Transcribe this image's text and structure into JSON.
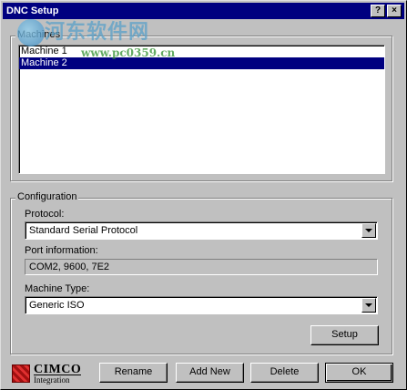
{
  "window": {
    "title": "DNC Setup",
    "help_label": "?",
    "close_label": "×"
  },
  "watermark": {
    "text": "河东软件网",
    "url": "www.pc0359.cn"
  },
  "machines": {
    "group_label": "Machines",
    "items": [
      {
        "label": "Machine 1",
        "selected": false
      },
      {
        "label": "Machine 2",
        "selected": true
      }
    ]
  },
  "configuration": {
    "group_label": "Configuration",
    "protocol_label": "Protocol:",
    "protocol_value": "Standard Serial Protocol",
    "port_info_label": "Port information:",
    "port_info_value": "COM2, 9600, 7E2",
    "machine_type_label": "Machine Type:",
    "machine_type_value": "Generic ISO",
    "setup_button": "Setup"
  },
  "footer": {
    "logo_text": "CIMCO",
    "logo_subtext": "Integration",
    "rename_button": "Rename",
    "add_new_button": "Add New",
    "delete_button": "Delete",
    "ok_button": "OK"
  },
  "colors": {
    "titlebar": "#000080",
    "face": "#c0c0c0",
    "selection": "#000080"
  }
}
